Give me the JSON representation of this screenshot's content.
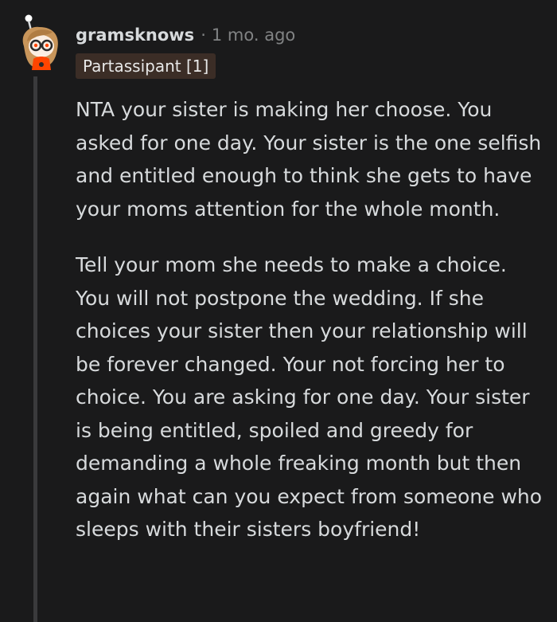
{
  "comment": {
    "author": "gramsknows",
    "separator": "·",
    "time": "1 mo. ago",
    "flair": "Partassipant [1]",
    "paragraphs": [
      "NTA your sister is making her choose. You asked for one day. Your sister is the one selfish and entitled enough to think she gets to have your moms attention for the whole month.",
      "Tell your mom she needs to make a choice. You will not postpone the wedding. If she choices your sister then your relationship will be forever changed. Your not forcing her to choice. You are asking for one day. Your sister is being entitled, spoiled and greedy for demanding a whole freaking month but then again what can you expect from someone who sleeps with their sisters boyfriend!"
    ]
  },
  "colors": {
    "background": "#1a1a1b",
    "text": "#d7dadc",
    "muted": "#818384",
    "flair_bg": "#3b2d26",
    "thread_line": "#3a3a3c",
    "avatar_accent": "#ff4500"
  },
  "icons": {
    "avatar": "snoo-avatar-icon"
  }
}
